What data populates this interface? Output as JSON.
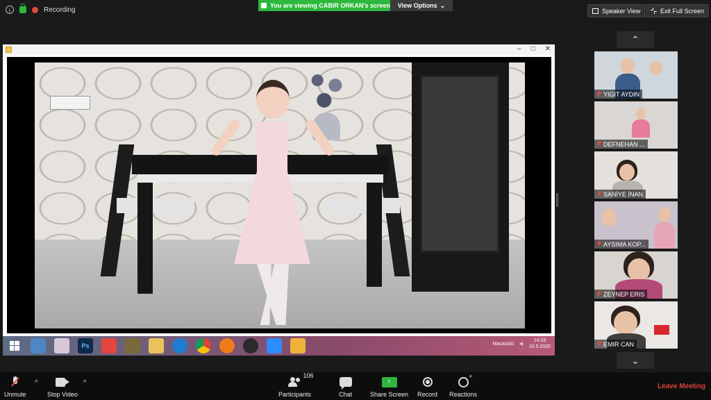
{
  "top_bar": {
    "recording_label": "Recording",
    "viewing_text": "You are viewing CABIR ORKAN's screen",
    "view_options_label": "View Options",
    "speaker_view_label": "Speaker View",
    "exit_full_screen_label": "Exit Full Screen"
  },
  "shared_window": {
    "taskbar": {
      "desktop_label": "Masaüstü",
      "time": "14:19",
      "date": "10.5.2020",
      "apps": [
        "windows-start",
        "computer",
        "paint",
        "photoshop",
        "anydesk",
        "mona-lisa",
        "file-explorer",
        "edge",
        "chrome",
        "firefox",
        "pen-tool",
        "zoom",
        "media-player"
      ]
    }
  },
  "participants": [
    {
      "name": "YIGIT AYDIN"
    },
    {
      "name": "DEFNEHAN ..."
    },
    {
      "name": "SANİYE İNAN"
    },
    {
      "name": "AYSIMA KOP..."
    },
    {
      "name": "ZEYNEP ERIS"
    },
    {
      "name": "EMIR CAN"
    }
  ],
  "bottom_bar": {
    "unmute_label": "Unmute",
    "stop_video_label": "Stop Video",
    "participants_label": "Participants",
    "participants_count": "106",
    "chat_label": "Chat",
    "share_screen_label": "Share Screen",
    "record_label": "Record",
    "reactions_label": "Reactions",
    "leave_label": "Leave Meeting"
  },
  "colors": {
    "zoom_green": "#2db83d",
    "leave_red": "#e0413a",
    "toolbar_bg": "#0d0d0d"
  }
}
